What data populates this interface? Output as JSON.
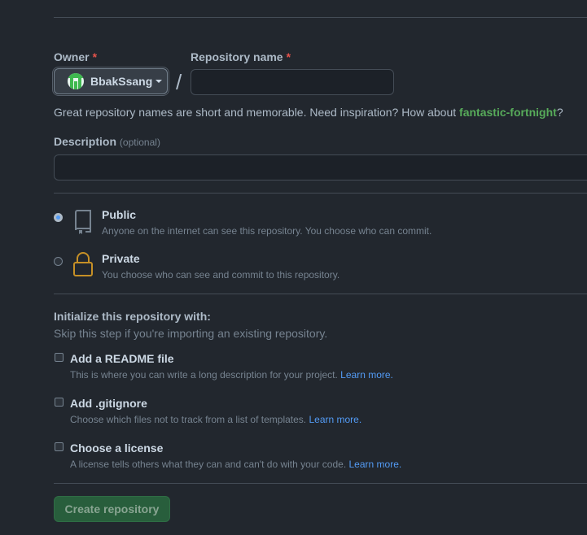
{
  "owner": {
    "label": "Owner",
    "required_mark": "*",
    "selected": "BbakSsang"
  },
  "separator": "/",
  "repo_name": {
    "label": "Repository name",
    "required_mark": "*",
    "value": "",
    "placeholder": ""
  },
  "name_hint": {
    "text": "Great repository names are short and memorable. Need inspiration? How about ",
    "suggestion": "fantastic-fortnight",
    "suffix": "?"
  },
  "description": {
    "label": "Description",
    "optional": "(optional)",
    "value": ""
  },
  "visibility": [
    {
      "title": "Public",
      "desc": "Anyone on the internet can see this repository. You choose who can commit.",
      "icon": "repo-icon",
      "selected": true
    },
    {
      "title": "Private",
      "desc": "You choose who can see and commit to this repository.",
      "icon": "lock-icon",
      "selected": false
    }
  ],
  "init": {
    "heading": "Initialize this repository with:",
    "subtext": "Skip this step if you're importing an existing repository.",
    "options": [
      {
        "title": "Add a README file",
        "desc": "This is where you can write a long description for your project.",
        "link": "Learn more.",
        "checked": false
      },
      {
        "title": "Add .gitignore",
        "desc": "Choose which files not to track from a list of templates.",
        "link": "Learn more.",
        "checked": false
      },
      {
        "title": "Choose a license",
        "desc": "A license tells others what they can and can't do with your code.",
        "link": "Learn more.",
        "checked": false
      }
    ]
  },
  "create_button": "Create repository",
  "colors": {
    "background": "#22272e",
    "accent_link": "#539bf5",
    "suggestion_green": "#57ab5a",
    "required_red": "#e5534b",
    "private_lock": "#c69026"
  }
}
